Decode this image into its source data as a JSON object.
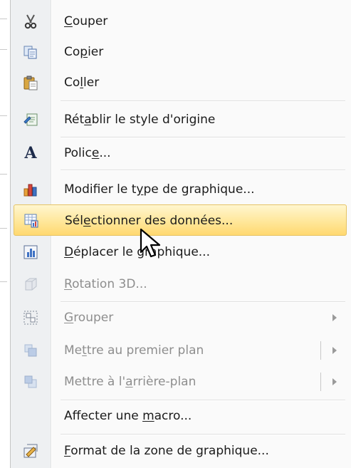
{
  "menu": {
    "items": [
      {
        "id": "couper",
        "pre": "",
        "acc": "C",
        "post": "ouper",
        "icon": "scissors-icon",
        "disabled": false
      },
      {
        "id": "copier",
        "pre": "Co",
        "acc": "p",
        "post": "ier",
        "icon": "copy-icon",
        "disabled": false
      },
      {
        "id": "coller",
        "pre": "Co",
        "acc": "l",
        "post": "ler",
        "icon": "paste-icon",
        "disabled": false
      },
      {
        "id": "retablir",
        "pre": "Rét",
        "acc": "a",
        "post": "blir le style d'origine",
        "icon": "reset-style-icon",
        "disabled": false
      },
      {
        "id": "police",
        "pre": "Polic",
        "acc": "e",
        "post": "...",
        "icon": "font-icon",
        "disabled": false
      },
      {
        "id": "modifier-type",
        "pre": "Modifier le t",
        "acc": "y",
        "post": "pe de graphique...",
        "icon": "chart-type-icon",
        "disabled": false
      },
      {
        "id": "selectionner",
        "pre": "Sél",
        "acc": "e",
        "post": "ctionner des données...",
        "icon": "select-data-icon",
        "disabled": false,
        "highlight": true
      },
      {
        "id": "deplacer",
        "pre": "",
        "acc": "D",
        "post": "éplacer le graphique...",
        "icon": "move-chart-icon",
        "disabled": false
      },
      {
        "id": "rotation",
        "pre": "",
        "acc": "R",
        "post": "otation 3D...",
        "icon": "rotation-3d-icon",
        "disabled": true
      },
      {
        "id": "grouper",
        "pre": "",
        "acc": "G",
        "post": "rouper",
        "icon": "group-icon",
        "disabled": true,
        "submenu": true
      },
      {
        "id": "premier-plan",
        "pre": "Me",
        "acc": "t",
        "post": "tre au premier plan",
        "icon": "bring-front-icon",
        "disabled": true,
        "submenu": true,
        "split": true
      },
      {
        "id": "arriere-plan",
        "pre": "Mettre à l'",
        "acc": "a",
        "post": "rrière-plan",
        "icon": "send-back-icon",
        "disabled": true,
        "submenu": true,
        "split": true
      },
      {
        "id": "affecter-macro",
        "pre": "Affecter une ",
        "acc": "m",
        "post": "acro...",
        "icon": "",
        "disabled": false
      },
      {
        "id": "format-zone",
        "pre": "",
        "acc": "F",
        "post": "ormat de la zone de graphique...",
        "icon": "format-chart-area-icon",
        "disabled": false
      }
    ]
  },
  "colors": {
    "highlight": "#ffe79a",
    "disabled_text": "#8e8e8e",
    "text": "#1b1b1b"
  }
}
